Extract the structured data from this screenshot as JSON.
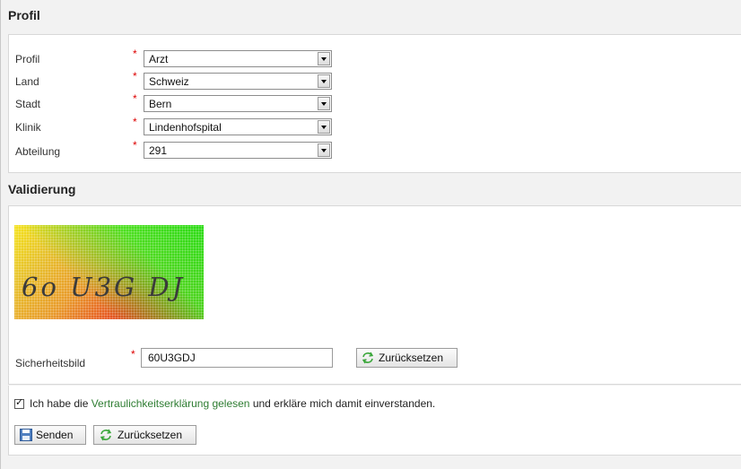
{
  "profil_section": {
    "title": "Profil",
    "fields": [
      {
        "label": "Profil",
        "value": "Arzt"
      },
      {
        "label": "Land",
        "value": "Schweiz"
      },
      {
        "label": "Stadt",
        "value": "Bern"
      },
      {
        "label": "Klinik",
        "value": "Lindenhofspital"
      },
      {
        "label": "Abteilung",
        "value": "291"
      }
    ],
    "required_mark": "*"
  },
  "validation_section": {
    "title": "Validierung",
    "captcha_text": "6o U3G DJ",
    "security_label": "Sicherheitsbild",
    "security_value": "60U3GDJ",
    "reset_label": "Zurücksetzen"
  },
  "agreement": {
    "prefix": "Ich habe die ",
    "link": "Vertraulichkeitserklärung gelesen",
    "suffix": " und erkläre mich damit einverstanden."
  },
  "actions": {
    "send_label": "Senden",
    "reset_label": "Zurücksetzen"
  },
  "icons": {
    "reset": "refresh-icon",
    "save": "floppy-disk-icon"
  }
}
